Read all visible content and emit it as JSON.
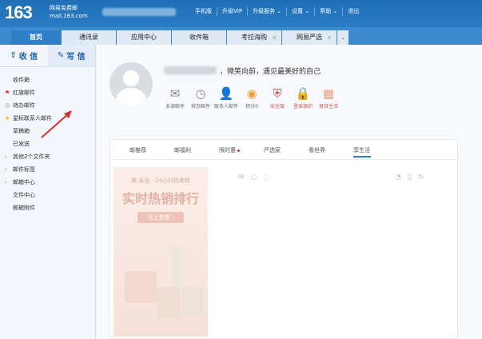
{
  "header": {
    "logo_number": "163",
    "logo_name": "网易免费邮",
    "logo_domain": "mail.163.com",
    "menu": [
      "手机版",
      "升级VIP",
      "升级服务 ⌄",
      "设置 ⌄",
      "帮助 ⌄",
      "退出"
    ]
  },
  "tabs": [
    {
      "label": "首页",
      "active": true
    },
    {
      "label": "通讯录"
    },
    {
      "label": "应用中心"
    },
    {
      "label": "收件箱"
    },
    {
      "label": "考拉海购",
      "close": "×"
    },
    {
      "label": "网易严选",
      "close": "×"
    }
  ],
  "tab_more": "⌄",
  "sidebar": {
    "receive_label": "收 信",
    "write_label": "写 信",
    "items": [
      {
        "label": "收件箱"
      },
      {
        "label": "红旗邮件",
        "mark": "⚑",
        "mark_color": "#d9302c"
      },
      {
        "label": "待办邮件",
        "mark": "◷",
        "mark_color": "#888888"
      },
      {
        "label": "星标联系人邮件",
        "mark": "★",
        "mark_color": "#f5b400"
      },
      {
        "label": "草稿箱"
      },
      {
        "label": "已发送"
      },
      {
        "label": "其他2个文件夹",
        "mark": "›",
        "mark_color": "#777777"
      },
      {
        "label": "邮件标签",
        "mark": "›",
        "mark_color": "#777777"
      },
      {
        "label": "邮箱中心",
        "mark": "›",
        "mark_color": "#777777"
      },
      {
        "label": "文件中心"
      },
      {
        "label": "邮箱附件"
      }
    ]
  },
  "main": {
    "greeting": "，微笑向前，遇见最美好的自己",
    "quick": [
      {
        "icon": "✉",
        "label": "未读邮件"
      },
      {
        "icon": "◷",
        "label": "待办邮件"
      },
      {
        "icon": "👤",
        "label": "联系人邮件"
      },
      {
        "icon": "◉",
        "label": "积分0",
        "color": "#f0a030"
      },
      {
        "icon": "⛨",
        "label": "安全度",
        "color": "#d9534f",
        "red": true
      },
      {
        "icon": "🔒",
        "label": "登录保护",
        "color": "#d9534f",
        "red": true
      },
      {
        "icon": "▦",
        "label": "每日生活",
        "color": "#e8a080",
        "red": true
      }
    ],
    "subtabs": [
      {
        "label": "邮推荐"
      },
      {
        "label": "邮福利"
      },
      {
        "label": "限时惠",
        "dot": true
      },
      {
        "label": "严选家"
      },
      {
        "label": "看世界"
      },
      {
        "label": "享生活",
        "active": true
      }
    ],
    "promo": {
      "subtitle": "某·家品 · 24小时热卖榜",
      "title": "实时热销排行",
      "cta": "马上查看 ›"
    }
  },
  "colors": {
    "brand": "#1f6fb6",
    "accent": "#2f7fc9",
    "red": "#d9302c"
  }
}
